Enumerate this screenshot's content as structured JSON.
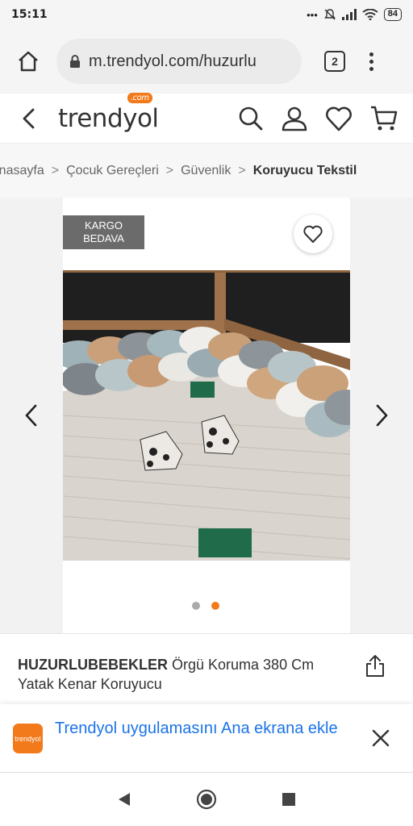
{
  "status_bar": {
    "time": "15:11",
    "dots": "•••",
    "battery": "84"
  },
  "browser": {
    "url": "m.trendyol.com/huzurlu",
    "tab_count": "2"
  },
  "site": {
    "logo_text": "trendyol",
    "logo_badge": ".com"
  },
  "breadcrumb": [
    {
      "label": "Anasayfa"
    },
    {
      "label": "Çocuk Gereçleri"
    },
    {
      "label": "Güvenlik"
    },
    {
      "label": "Koruyucu Tekstil"
    }
  ],
  "breadcrumb_sep": ">",
  "product": {
    "badge_line1": "KARGO",
    "badge_line2": "BEDAVA",
    "brand": "HUZURLUBEBEKLER",
    "name": " Örgü Koruma 380 Cm Yatak Kenar Koruyucu",
    "image_count": 2,
    "active_image": 2
  },
  "app_banner": {
    "logo_text": "trendyol",
    "text": "Trendyol uygulamasını Ana ekrana ekle"
  },
  "colors": {
    "accent": "#f27a1a",
    "link": "#1a73e8",
    "text": "#333333"
  },
  "icons": [
    "home-icon",
    "lock-icon",
    "tabs-icon",
    "more-icon",
    "back-icon",
    "search-icon",
    "user-icon",
    "heart-icon",
    "cart-icon",
    "share-icon",
    "close-icon",
    "nav-back-icon",
    "nav-home-icon",
    "nav-recents-icon"
  ]
}
